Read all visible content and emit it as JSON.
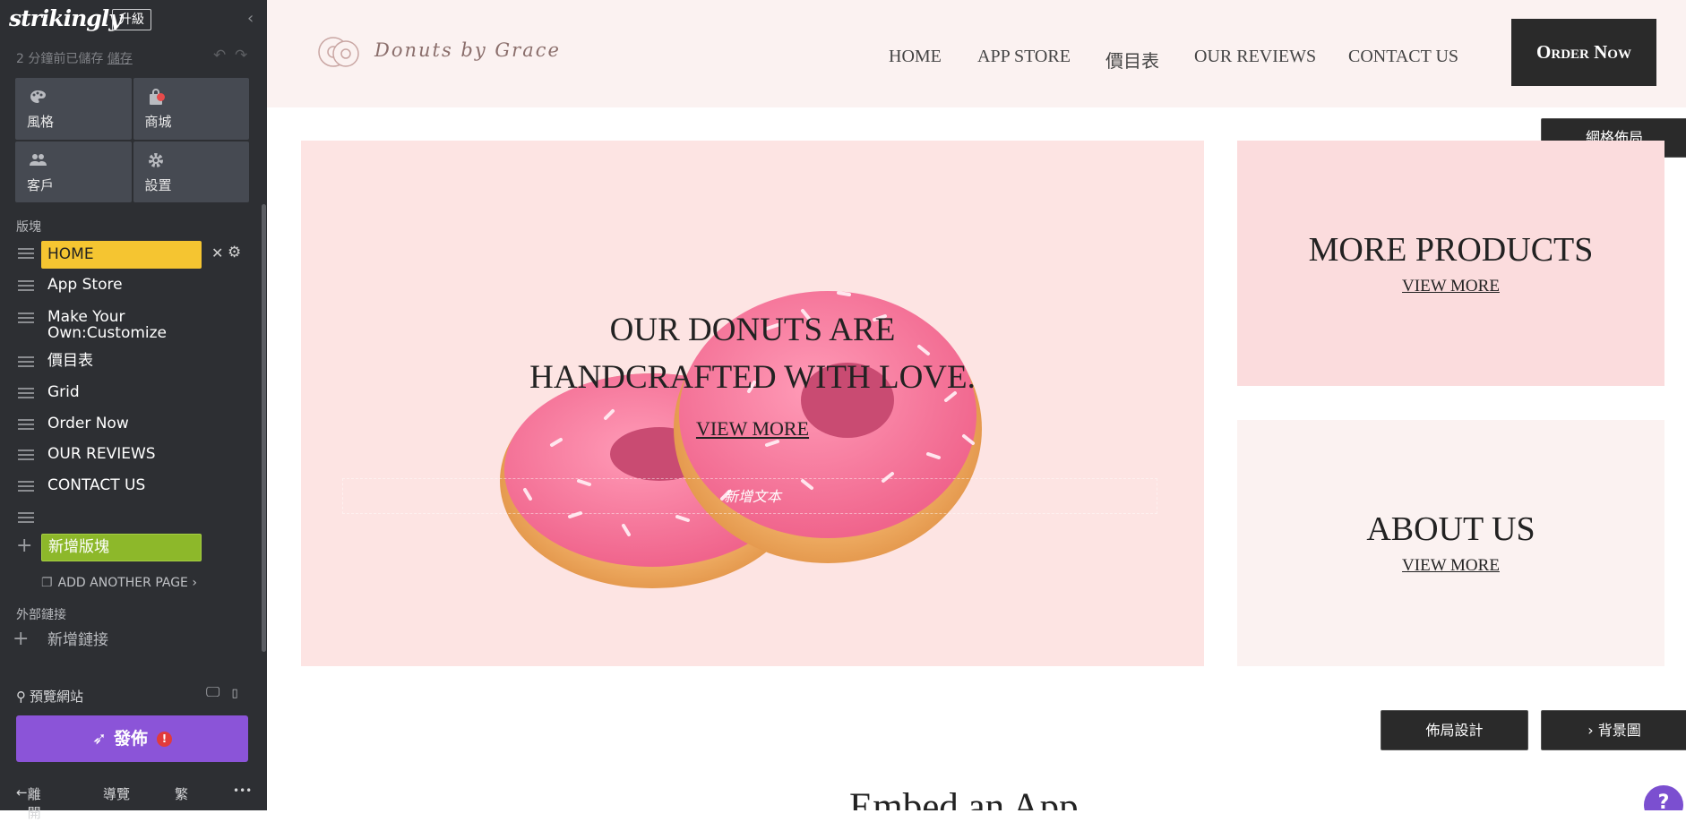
{
  "sidebar": {
    "logo": "strikingly",
    "upgrade_label": "升級",
    "saved_text": "2 分鐘前已儲存",
    "save_link": "儲存",
    "tiles": [
      {
        "label": "風格",
        "icon": "palette-icon"
      },
      {
        "label": "商城",
        "icon": "shopping-bag-icon"
      },
      {
        "label": "客戶",
        "icon": "users-icon"
      },
      {
        "label": "設置",
        "icon": "gear-icon"
      }
    ],
    "sections_heading": "版塊",
    "nav_items": [
      {
        "label": "HOME"
      },
      {
        "label": "App Store"
      },
      {
        "label": "Make Your Own:Customize"
      },
      {
        "label": "價目表"
      },
      {
        "label": "Grid"
      },
      {
        "label": "Order Now"
      },
      {
        "label": "OUR REVIEWS"
      },
      {
        "label": "CONTACT US"
      }
    ],
    "add_section_label": "新增版塊",
    "add_page_label": "ADD ANOTHER PAGE",
    "external_links_heading": "外部鏈接",
    "add_link_label": "新增鏈接",
    "preview_label": "預覽網站",
    "publish_label": "發佈",
    "publish_alert": "!",
    "footer": {
      "leave": "離開",
      "guide": "導覽",
      "lang": "繁",
      "more": "•••"
    }
  },
  "site": {
    "brand_name": "Donuts by Grace",
    "menu": [
      "HOME",
      "APP STORE",
      "價目表",
      "OUR REVIEWS",
      "CONTACT US"
    ],
    "order_now": "Order Now",
    "grid_layout_btn": "網格佈局",
    "hero": {
      "title_line1": "OUR DONUTS ARE",
      "title_line2": "HANDCRAFTED WITH LOVE.",
      "link": "VIEW MORE",
      "placeholder": "新增文本"
    },
    "card_products": {
      "title": "MORE PRODUCTS",
      "link": "VIEW MORE"
    },
    "card_about": {
      "title": "ABOUT US",
      "link": "VIEW MORE"
    },
    "layout_btn": "佈局設計",
    "background_btn": "背景圖",
    "next_heading": "Embed an App",
    "help": "?",
    "colors": {
      "hero_bg": "#fde4e3",
      "card1_bg": "#fbdcdd",
      "card2_bg": "#fbf2f1",
      "publish": "#8b54d8",
      "home_highlight": "#f5c531",
      "add_section": "#8db82a"
    }
  }
}
